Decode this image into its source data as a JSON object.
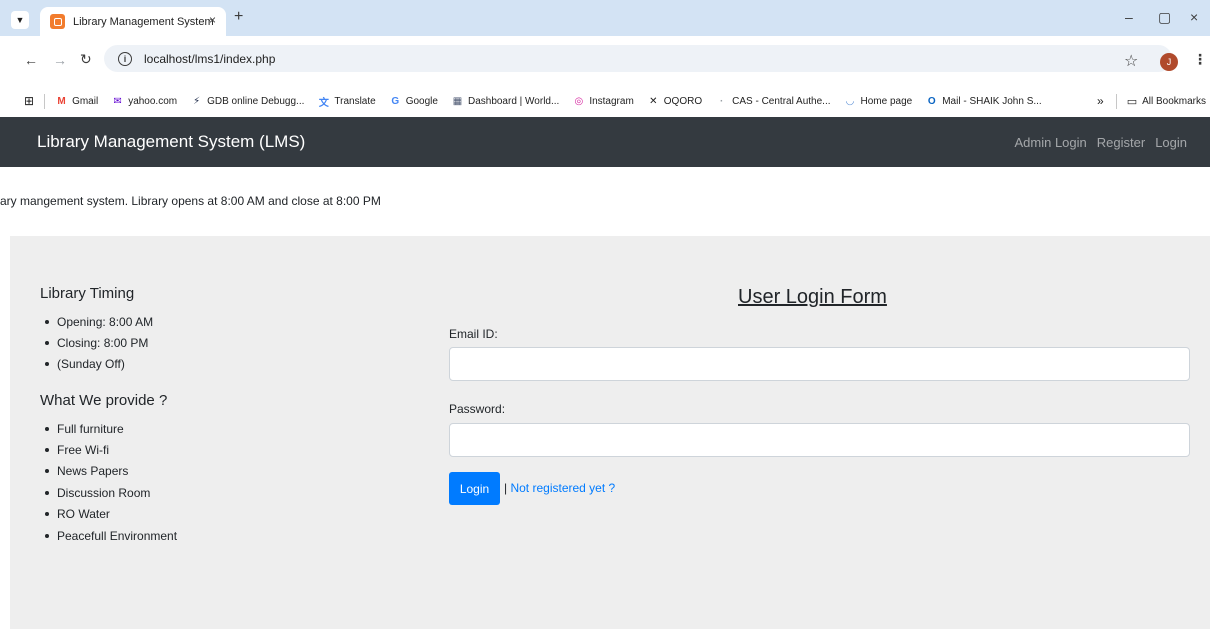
{
  "browser": {
    "tab_title": "Library Management System",
    "tab_close": "×",
    "new_tab": "+",
    "url": "localhost/lms1/index.php",
    "avatar_initial": "J",
    "window_controls": [
      "–",
      "▢",
      "×"
    ],
    "bookmarks": [
      {
        "label": "Gmail",
        "icon": "gmail-icon",
        "color": "#ea4335",
        "glyph": "M"
      },
      {
        "label": "yahoo.com",
        "icon": "mail-icon",
        "color": "#5f01d1",
        "glyph": "✉"
      },
      {
        "label": "GDB online Debugg...",
        "icon": "gdb-icon",
        "color": "#1e2b4a",
        "glyph": "⚡"
      },
      {
        "label": "Translate",
        "icon": "translate-icon",
        "color": "#4285f4",
        "glyph": "文"
      },
      {
        "label": "Google",
        "icon": "google-icon",
        "color": "#4285f4",
        "glyph": "G"
      },
      {
        "label": "Dashboard | World...",
        "icon": "dashboard-icon",
        "color": "#4a5670",
        "glyph": "▦"
      },
      {
        "label": "Instagram",
        "icon": "instagram-icon",
        "color": "#d6249f",
        "glyph": "◎"
      },
      {
        "label": "OQORO",
        "icon": "oqoro-icon",
        "color": "#222222",
        "glyph": "✕"
      },
      {
        "label": "CAS - Central Authe...",
        "icon": "cas-icon",
        "color": "#9aa0a6",
        "glyph": "·"
      },
      {
        "label": "Home page",
        "icon": "homepage-icon",
        "color": "#5a8fd6",
        "glyph": "◡"
      },
      {
        "label": "Mail - SHAIK John S...",
        "icon": "outlook-icon",
        "color": "#0a64c2",
        "glyph": "O"
      }
    ],
    "bookmarks_overflow": "»",
    "all_bookmarks": "All Bookmarks"
  },
  "site": {
    "brand": "Library Management System (LMS)",
    "nav_links": [
      "Admin Login",
      "Register",
      "Login"
    ],
    "marquee": "ary mangement system. Library opens at 8:00 AM and close at 8:00 PM",
    "sidebar": {
      "timing_heading": "Library Timing",
      "timing_items": [
        "Opening: 8:00 AM",
        "Closing: 8:00 PM",
        "(Sunday Off)"
      ],
      "provide_heading": "What We provide ?",
      "provide_items": [
        "Full furniture",
        "Free Wi-fi",
        "News Papers",
        "Discussion Room",
        "RO Water",
        "Peacefull Environment"
      ]
    },
    "form": {
      "title": "User Login Form",
      "email_label": "Email ID:",
      "email_value": "",
      "password_label": "Password:",
      "password_value": "",
      "login_button": "Login",
      "separator": "|",
      "register_link": "Not registered yet ?"
    }
  },
  "colors": {
    "navbar_bg": "#343a40",
    "primary": "#007bff",
    "jumbotron_bg": "#eeeeee",
    "tabstrip_bg": "#d3e3f4"
  }
}
